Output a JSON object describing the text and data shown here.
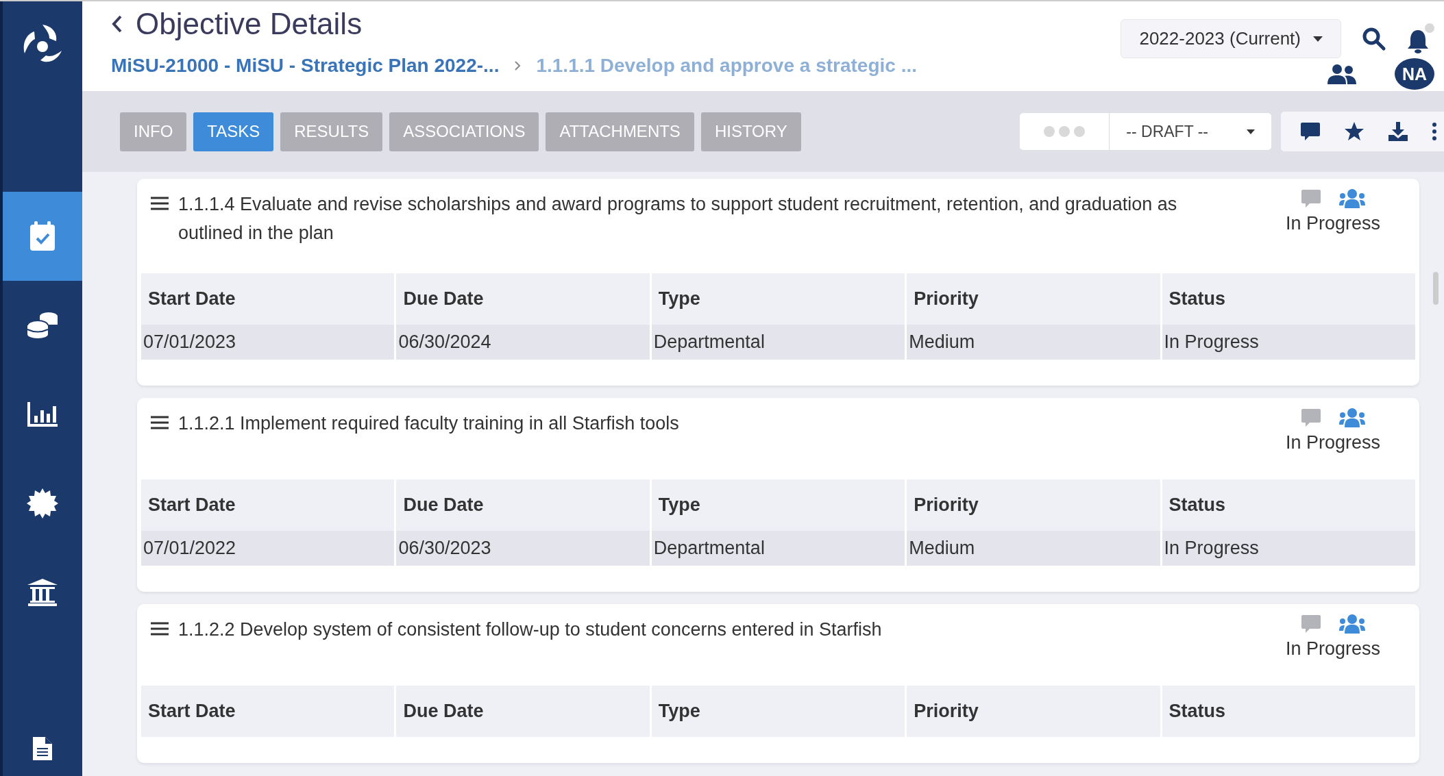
{
  "header": {
    "title": "Objective Details",
    "breadcrumb": [
      {
        "label": "MiSU-21000 - MiSU - Strategic Plan 2022-...",
        "current": false
      },
      {
        "label": "1.1.1.1 Develop and approve a strategic ...",
        "current": true
      }
    ],
    "year_select": "2022-2023 (Current)",
    "avatar": "NA",
    "notification_dot": true
  },
  "sidebar": {
    "items": [
      {
        "selected": true
      },
      {
        "selected": false
      },
      {
        "selected": false
      },
      {
        "selected": false
      },
      {
        "selected": false
      },
      {
        "selected": false
      }
    ]
  },
  "tabs": [
    {
      "label": "INFO",
      "selected": false
    },
    {
      "label": "TASKS",
      "selected": true
    },
    {
      "label": "RESULTS",
      "selected": false
    },
    {
      "label": "ASSOCIATIONS",
      "selected": false
    },
    {
      "label": "ATTACHMENTS",
      "selected": false
    },
    {
      "label": "HISTORY",
      "selected": false
    }
  ],
  "status_select": "-- DRAFT --",
  "tasks": [
    {
      "title": "1.1.1.4 Evaluate and revise scholarships and award programs to support student recruitment, retention, and graduation as outlined in the plan",
      "status": "In Progress",
      "columns": [
        "Start Date",
        "Due Date",
        "Type",
        "Priority",
        "Status"
      ],
      "rows": [
        [
          "07/01/2023",
          "06/30/2024",
          "Departmental",
          "Medium",
          "In Progress"
        ]
      ]
    },
    {
      "title": "1.1.2.1 Implement required faculty training in all Starfish tools",
      "status": "In Progress",
      "columns": [
        "Start Date",
        "Due Date",
        "Type",
        "Priority",
        "Status"
      ],
      "rows": [
        [
          "07/01/2022",
          "06/30/2023",
          "Departmental",
          "Medium",
          "In Progress"
        ]
      ]
    },
    {
      "title": "1.1.2.2 Develop system of consistent follow-up to student concerns entered in Starfish",
      "status": "In Progress",
      "columns": [
        "Start Date",
        "Due Date",
        "Type",
        "Priority",
        "Status"
      ]
    }
  ]
}
